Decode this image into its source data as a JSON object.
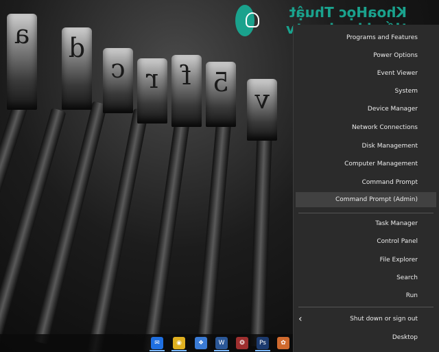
{
  "logo": {
    "wordmark": "KhoaHọc Thuật tiến khoahoc.tv"
  },
  "context_menu": {
    "items": [
      {
        "label": "Programs and Features"
      },
      {
        "label": "Power Options"
      },
      {
        "label": "Event Viewer"
      },
      {
        "label": "System"
      },
      {
        "label": "Device Manager"
      },
      {
        "label": "Network Connections"
      },
      {
        "label": "Disk Management"
      },
      {
        "label": "Computer Management"
      },
      {
        "label": "Command Prompt"
      },
      {
        "label": "Command Prompt (Admin)"
      },
      {
        "label": "Task Manager"
      },
      {
        "label": "Control Panel"
      },
      {
        "label": "File Explorer"
      },
      {
        "label": "Search"
      },
      {
        "label": "Run"
      },
      {
        "label": "Shut down or sign out"
      },
      {
        "label": "Desktop"
      }
    ],
    "highlighted": "Command Prompt (Admin)"
  },
  "taskbar": {
    "icons": [
      {
        "name": "messenger-icon",
        "glyph": "✉",
        "color": "#1f6fe0"
      },
      {
        "name": "chrome-icon",
        "glyph": "◉",
        "color": "#e0b020"
      },
      {
        "name": "photos-icon",
        "glyph": "❖",
        "color": "#3a7bd5"
      },
      {
        "name": "word-icon",
        "glyph": "W",
        "color": "#2b5797"
      },
      {
        "name": "nox-icon",
        "glyph": "❂",
        "color": "#9e2f2f"
      },
      {
        "name": "photoshop-icon",
        "glyph": "Ps",
        "color": "#1c3a6e"
      },
      {
        "name": "paint-icon",
        "glyph": "✿",
        "color": "#d06a2e"
      }
    ]
  },
  "wallpaper": {
    "keys": [
      "a",
      "d",
      "c",
      "r",
      "f",
      "5",
      "v"
    ]
  },
  "colors": {
    "menu_bg": "#2b2b2b",
    "menu_highlight": "#414141",
    "menu_text": "#ededed",
    "accent": "#1aa28d"
  }
}
